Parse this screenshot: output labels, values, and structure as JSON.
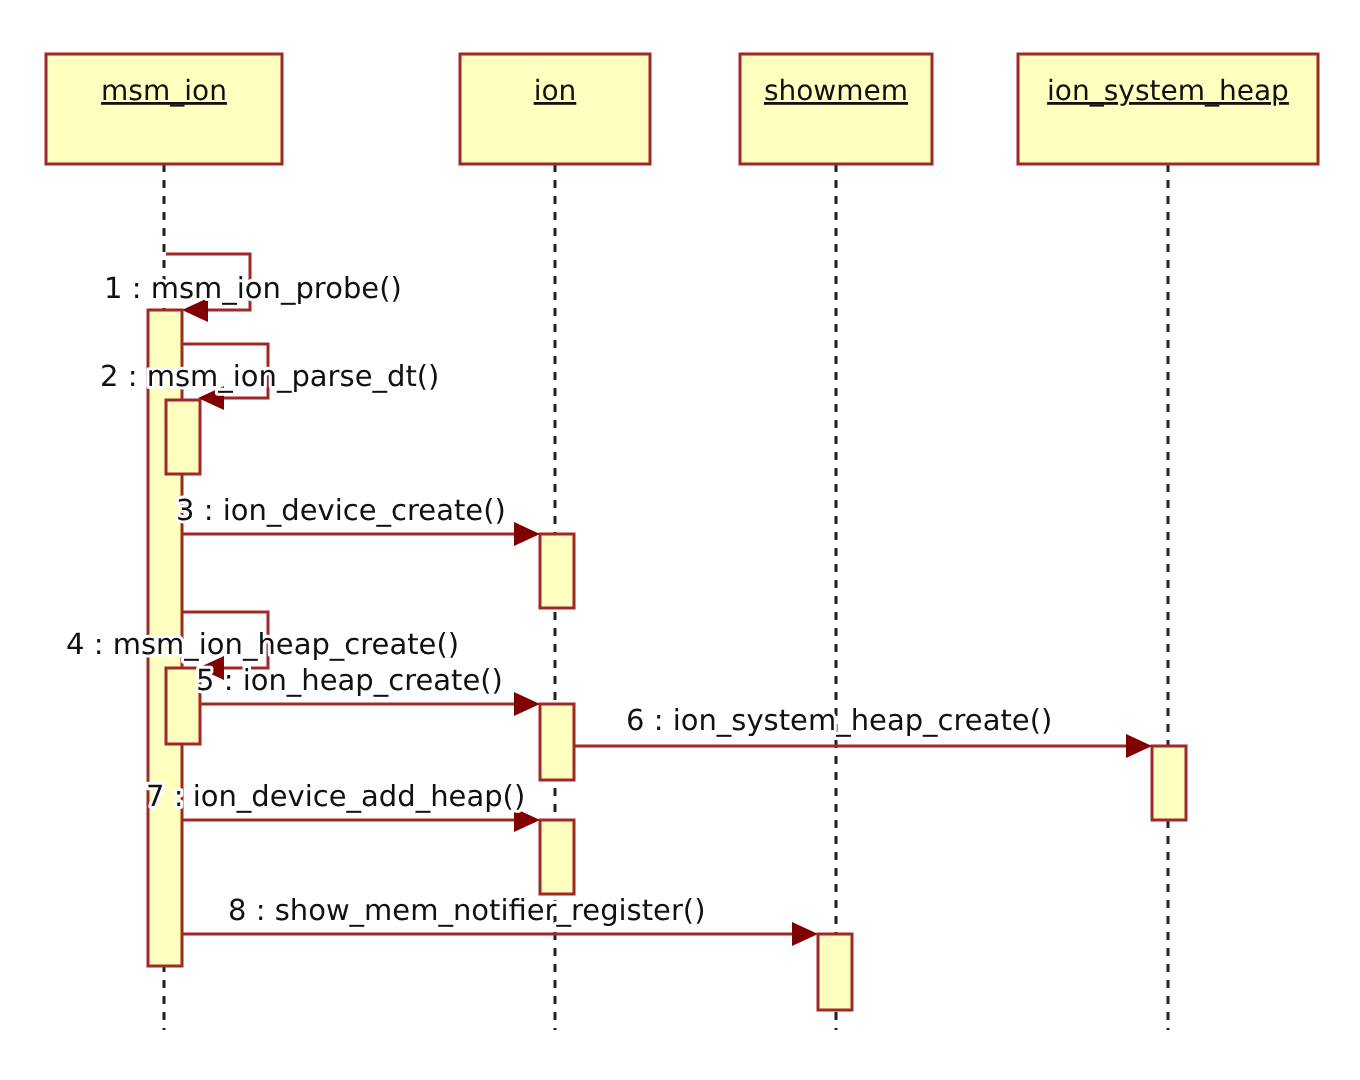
{
  "lifelines": [
    {
      "name": "msm_ion"
    },
    {
      "name": "ion"
    },
    {
      "name": "showmem"
    },
    {
      "name": "ion_system_heap"
    }
  ],
  "messages": [
    {
      "kind": "self",
      "label": "1 : msm_ion_probe()"
    },
    {
      "kind": "self",
      "label": "2 : msm_ion_parse_dt()"
    },
    {
      "kind": "call",
      "label": "3 : ion_device_create()"
    },
    {
      "kind": "self",
      "label": "4 : msm_ion_heap_create()"
    },
    {
      "kind": "call",
      "label": "5 : ion_heap_create()"
    },
    {
      "kind": "call",
      "label": "6 : ion_system_heap_create()"
    },
    {
      "kind": "call",
      "label": "7 : ion_device_add_heap()"
    },
    {
      "kind": "call",
      "label": "8 : show_mem_notifier_register()"
    }
  ]
}
